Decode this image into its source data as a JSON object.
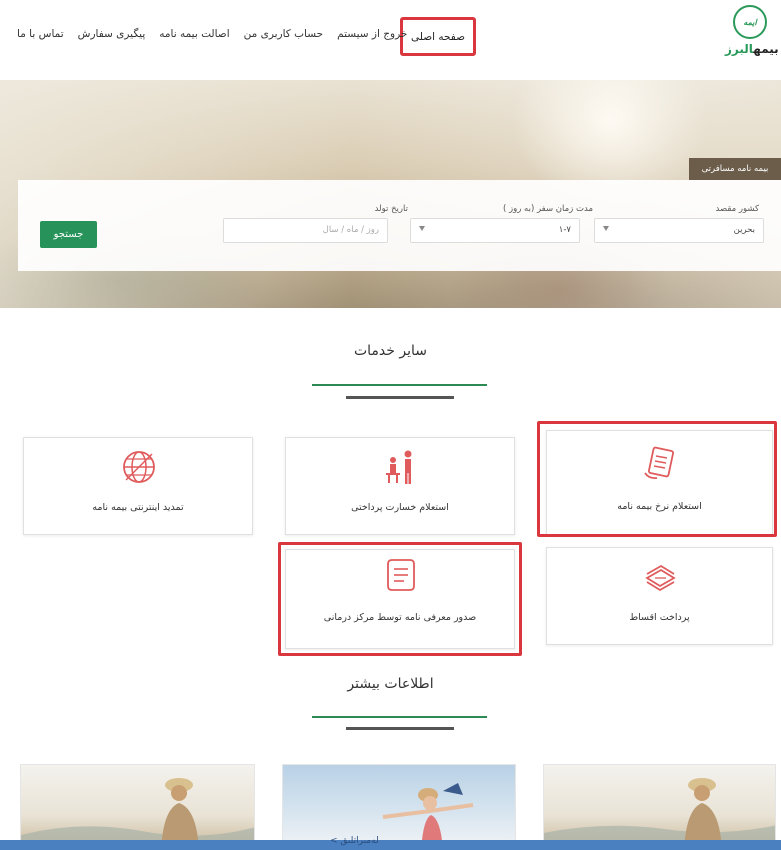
{
  "nav": {
    "home": "صفحه اصلی",
    "items": [
      "تماس با ما",
      "پیگیری سفارش",
      "اصالت بیمه نامه",
      "حساب کاربری من",
      "خروج از سیستم"
    ]
  },
  "logo": {
    "mark": "ایمه",
    "name_a": "بیمه",
    "name_b": "البرز"
  },
  "hero": {
    "tab_label": "بیمه نامه مسافرتی",
    "destination_label": "کشور مقصد",
    "destination_value": "بحرین",
    "duration_label": "مدت زمان سفر (به روز )",
    "duration_value": "۱-۷",
    "birthdate_label": "تاریخ تولد",
    "birthdate_placeholder": "روز / ماه / سال",
    "search_button": "جستجو"
  },
  "services": {
    "title": "سایر خدمات",
    "cards": [
      {
        "label": "استعلام نرخ بیمه نامه"
      },
      {
        "label": "استعلام خسارت پرداختی"
      },
      {
        "label": "تمدید اینترنتی بیمه نامه"
      },
      {
        "label": "پرداخت اقساط"
      },
      {
        "label": "صدور معرفی نامه توسط مرکز درمانی"
      }
    ]
  },
  "more": {
    "title": "اطلاعات بیشتر"
  },
  "footer_fragment": "< لەمىراتلىق",
  "colors": {
    "brand_green": "#27935a",
    "highlight_red": "#d9363e",
    "footer_blue": "#4a7fc0"
  }
}
